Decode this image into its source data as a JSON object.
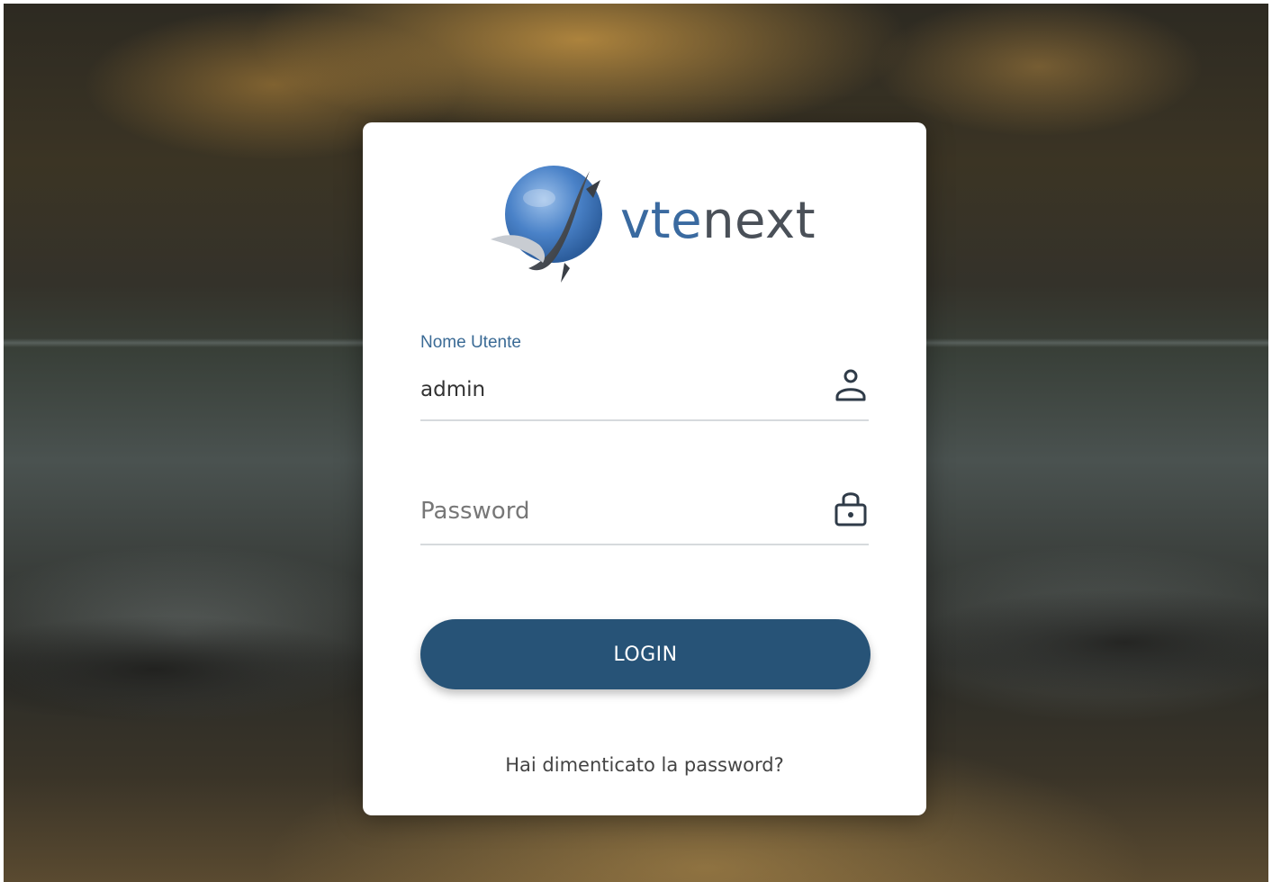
{
  "logo": {
    "brand_part1": "vte",
    "brand_part2": "next",
    "mark_icon": "whale-globe-icon",
    "colors": {
      "blue": "#3a6aa0",
      "gray": "#4a5058"
    }
  },
  "form": {
    "username": {
      "label": "Nome Utente",
      "value": "admin",
      "icon": "user-icon"
    },
    "password": {
      "placeholder": "Password",
      "value": "",
      "icon": "lock-icon"
    },
    "login_label": "LOGIN",
    "forgot_label": "Hai dimenticato la password?"
  },
  "theme": {
    "button_color": "#275377",
    "label_color": "#3a6a95"
  }
}
